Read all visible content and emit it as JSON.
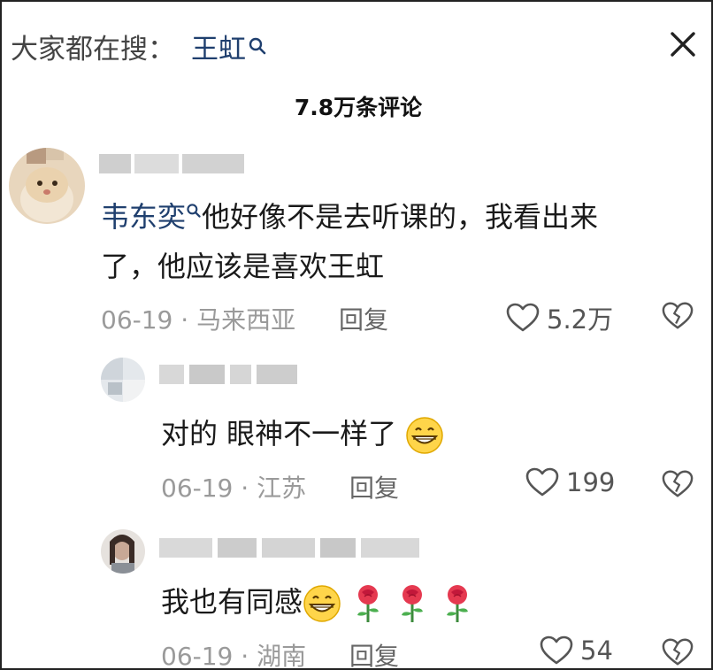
{
  "search_bar": {
    "prefix": "大家都在搜：",
    "keyword": "王虹"
  },
  "comment_count_title": "7.8万条评论",
  "comments": [
    {
      "mention": "韦东奕",
      "text_line1": "他好像不是去听课的，我看出来",
      "text_line2": "了，他应该是喜欢王虹",
      "date": "06-19",
      "location": "马来西亚",
      "reply_label": "回复",
      "likes": "5.2万"
    },
    {
      "text": "对的 眼神不一样了",
      "date": "06-19",
      "location": "江苏",
      "reply_label": "回复",
      "likes": "199"
    },
    {
      "text": "我也有同感",
      "date": "06-19",
      "location": "湖南",
      "reply_label": "回复",
      "likes": "54"
    }
  ],
  "separator": " · ",
  "icons": {
    "search": "search-icon",
    "close": "close-icon",
    "like": "heart-icon",
    "dislike": "broken-heart-icon",
    "grin": "grin-emoji",
    "rose": "rose-emoji"
  },
  "colors": {
    "mention": "#1f3f6e",
    "meta": "#9a9a9a",
    "text": "#1a1a1a"
  }
}
